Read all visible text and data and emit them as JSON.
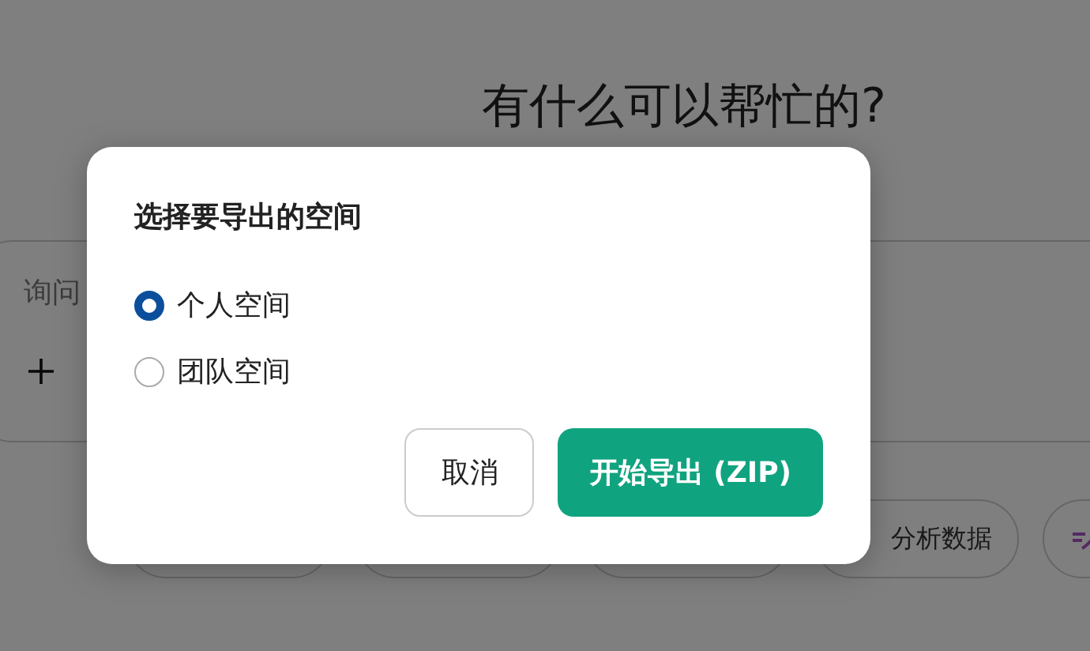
{
  "background": {
    "heading": "有什么可以帮忙的?",
    "prompt": {
      "placeholder": "询问"
    },
    "chips": [
      {
        "kind": "blank"
      },
      {
        "kind": "blank"
      },
      {
        "kind": "blank"
      },
      {
        "kind": "text",
        "label": "分析数据"
      },
      {
        "kind": "icon"
      }
    ]
  },
  "dialog": {
    "title": "选择要导出的空间",
    "options": [
      {
        "label": "个人空间",
        "selected": true
      },
      {
        "label": "团队空间",
        "selected": false
      }
    ],
    "buttons": [
      {
        "label": "取消",
        "kind": "secondary"
      },
      {
        "label": "开始导出 (ZIP)",
        "kind": "primary"
      }
    ]
  }
}
